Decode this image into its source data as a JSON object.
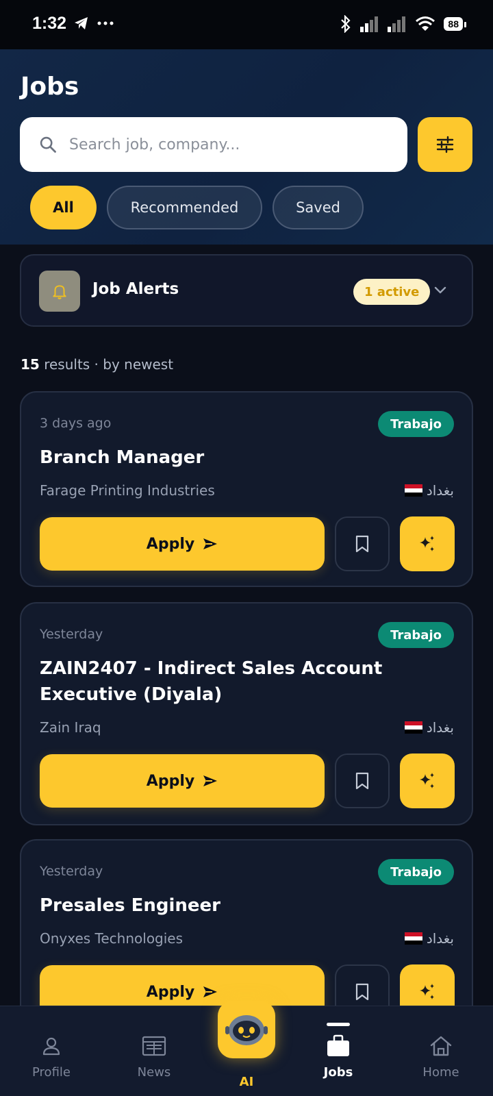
{
  "status_bar": {
    "time": "1:32",
    "battery": "88"
  },
  "header": {
    "title": "Jobs",
    "search_placeholder": "Search job, company...",
    "chips": [
      {
        "label": "All",
        "active": true
      },
      {
        "label": "Recommended",
        "active": false
      },
      {
        "label": "Saved",
        "active": false
      }
    ]
  },
  "alerts": {
    "title": "Job Alerts",
    "badge": "1 active"
  },
  "results": {
    "count": "15",
    "suffix": " results · by newest"
  },
  "jobs": [
    {
      "posted": "3 days ago",
      "tag": "Trabajo",
      "title": "Branch Manager",
      "company": "Farage Printing Industries",
      "location": "بغداد",
      "apply_label": "Apply"
    },
    {
      "posted": "Yesterday",
      "tag": "Trabajo",
      "title": "ZAIN2407 - Indirect Sales Account Executive (Diyala)",
      "company": "Zain Iraq",
      "location": "بغداد",
      "apply_label": "Apply"
    },
    {
      "posted": "Yesterday",
      "tag": "Trabajo",
      "title": "Presales Engineer",
      "company": "Onyxes Technologies",
      "location": "بغداد",
      "apply_label": "Apply"
    }
  ],
  "bottom_nav": {
    "items": [
      {
        "label": "Profile",
        "icon": "person-icon"
      },
      {
        "label": "News",
        "icon": "newspaper-icon"
      },
      {
        "label": "AI",
        "icon": "robot-icon"
      },
      {
        "label": "Jobs",
        "icon": "briefcase-icon",
        "active": true
      },
      {
        "label": "Home",
        "icon": "home-icon"
      }
    ]
  },
  "colors": {
    "accent": "#fdc82d",
    "tag_bg": "#0c8a74",
    "background": "#0b0f1a",
    "card": "#121a2c",
    "header": "#122746"
  }
}
